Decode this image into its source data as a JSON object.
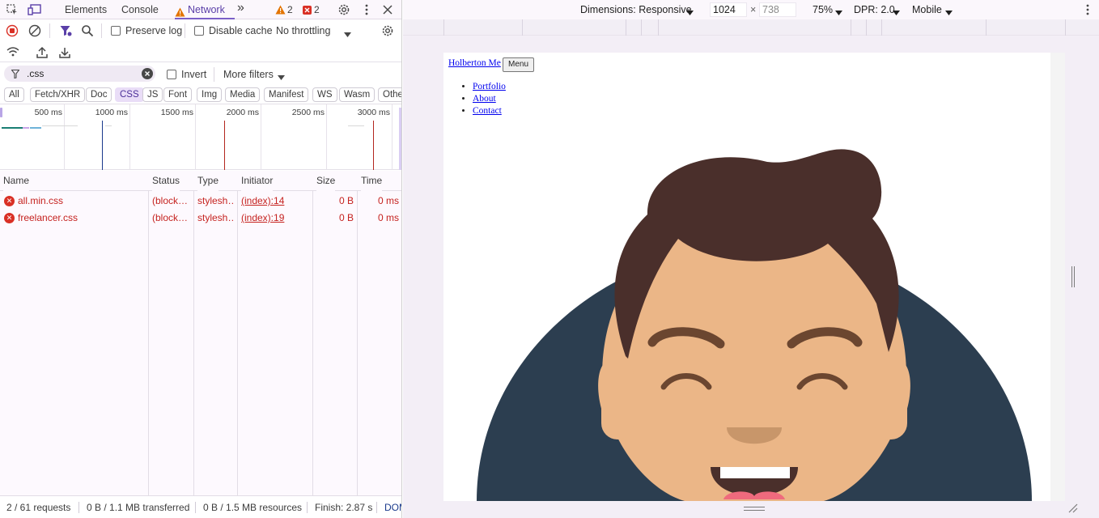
{
  "tabs": {
    "elements": "Elements",
    "console": "Console",
    "network": "Network",
    "more": "»",
    "warnings": "2",
    "errors": "2"
  },
  "toolbar": {
    "preserve_log": "Preserve log",
    "disable_cache": "Disable cache",
    "throttling": "No throttling"
  },
  "filter": {
    "value": ".css",
    "invert": "Invert",
    "more_filters": "More filters"
  },
  "type_filters": [
    "All",
    "Fetch/XHR",
    "Doc",
    "CSS",
    "JS",
    "Font",
    "Img",
    "Media",
    "Manifest",
    "WS",
    "Wasm",
    "Othe"
  ],
  "selected_type": "CSS",
  "timeline": {
    "ticks": [
      "500 ms",
      "1000 ms",
      "1500 ms",
      "2000 ms",
      "2500 ms",
      "3000 ms"
    ]
  },
  "columns": [
    "Name",
    "Status",
    "Type",
    "Initiator",
    "Size",
    "Time"
  ],
  "requests": [
    {
      "name": "all.min.css",
      "status": "(block…",
      "type": "stylesh…",
      "initiator": "(index):14",
      "size": "0 B",
      "time": "0 ms"
    },
    {
      "name": "freelancer.css",
      "status": "(block…",
      "type": "stylesh…",
      "initiator": "(index):19",
      "size": "0 B",
      "time": "0 ms"
    }
  ],
  "status": {
    "requests": "2 / 61 requests",
    "transferred": "0 B / 1.1 MB transferred",
    "resources": "0 B / 1.5 MB resources",
    "finish": "Finish: 2.87 s",
    "dom": "DOM"
  },
  "device": {
    "dimensions": "Dimensions: Responsive",
    "width": "1024",
    "height": "738",
    "times": "×",
    "zoom": "75%",
    "dpr": "DPR: 2.0",
    "mode": "Mobile"
  },
  "site": {
    "brand": "Holberton Me",
    "menu_button": "Menu",
    "nav": [
      "Portfolio",
      "About",
      "Contact"
    ]
  },
  "colors": {
    "accent": "#7a5fc7",
    "error": "#d93025",
    "avatar_bg": "#2c3e50",
    "hair": "#4a2f2b",
    "skin": "#ebb687"
  }
}
